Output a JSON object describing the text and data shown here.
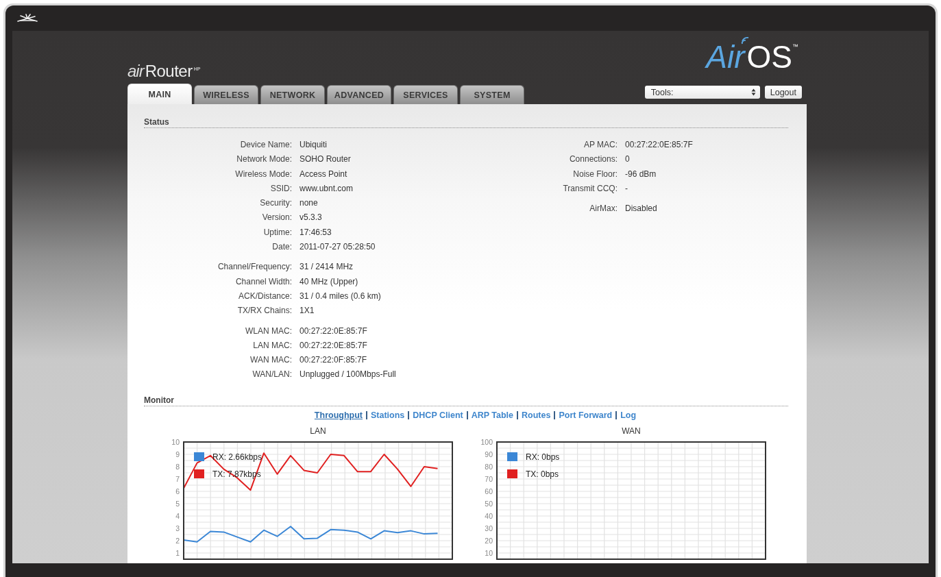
{
  "logo": {
    "prefix": "air",
    "name": "Router",
    "suffix": "HP"
  },
  "product_logo": {
    "air": "Air",
    "os": "OS",
    "tm": "™"
  },
  "tabs": [
    {
      "label": "MAIN",
      "selected": true
    },
    {
      "label": "WIRELESS",
      "selected": false
    },
    {
      "label": "NETWORK",
      "selected": false
    },
    {
      "label": "ADVANCED",
      "selected": false
    },
    {
      "label": "SERVICES",
      "selected": false
    },
    {
      "label": "SYSTEM",
      "selected": false
    }
  ],
  "tools": {
    "value": "Tools:"
  },
  "logout": "Logout",
  "status": {
    "title": "Status",
    "left": [
      [
        {
          "label": "Device Name:",
          "value": "Ubiquiti"
        },
        {
          "label": "Network Mode:",
          "value": "SOHO Router"
        },
        {
          "label": "Wireless Mode:",
          "value": "Access Point"
        },
        {
          "label": "SSID:",
          "value": "www.ubnt.com"
        },
        {
          "label": "Security:",
          "value": "none"
        },
        {
          "label": "Version:",
          "value": "v5.3.3"
        },
        {
          "label": "Uptime:",
          "value": "17:46:53"
        },
        {
          "label": "Date:",
          "value": "2011-07-27 05:28:50"
        }
      ],
      [
        {
          "label": "Channel/Frequency:",
          "value": "31 / 2414 MHz"
        },
        {
          "label": "Channel Width:",
          "value": "40 MHz (Upper)"
        },
        {
          "label": "ACK/Distance:",
          "value": "31 / 0.4 miles (0.6 km)"
        },
        {
          "label": "TX/RX Chains:",
          "value": "1X1"
        }
      ],
      [
        {
          "label": "WLAN MAC:",
          "value": "00:27:22:0E:85:7F"
        },
        {
          "label": "LAN MAC:",
          "value": "00:27:22:0E:85:7F"
        },
        {
          "label": "WAN MAC:",
          "value": "00:27:22:0F:85:7F"
        },
        {
          "label": "WAN/LAN:",
          "value": "Unplugged / 100Mbps-Full"
        }
      ]
    ],
    "right": [
      [
        {
          "label": "AP MAC:",
          "value": "00:27:22:0E:85:7F"
        },
        {
          "label": "Connections:",
          "value": "0"
        },
        {
          "label": "Noise Floor:",
          "value": "-96 dBm"
        },
        {
          "label": "Transmit CCQ:",
          "value": "-"
        }
      ],
      [
        {
          "label": "AirMax:",
          "value": "Disabled"
        }
      ]
    ]
  },
  "monitor": {
    "title": "Monitor",
    "links": [
      {
        "label": "Throughput",
        "selected": true
      },
      {
        "label": "Stations",
        "selected": false
      },
      {
        "label": "DHCP Client",
        "selected": false
      },
      {
        "label": "ARP Table",
        "selected": false
      },
      {
        "label": "Routes",
        "selected": false
      },
      {
        "label": "Port Forward",
        "selected": false
      },
      {
        "label": "Log",
        "selected": false
      }
    ],
    "charts": [
      {
        "title": "LAN",
        "chart_data": {
          "type": "line",
          "ylim": [
            0.5,
            10
          ],
          "yticks": [
            1,
            2,
            3,
            4,
            5,
            6,
            7,
            8,
            9,
            10
          ],
          "grid": true,
          "legend": true,
          "series": [
            {
              "name": "RX: 2.66kbps",
              "color": "#3b87d6",
              "values": [
                2.05,
                1.9,
                2.75,
                2.7,
                2.3,
                1.9,
                2.85,
                2.35,
                3.15,
                2.15,
                2.2,
                2.9,
                2.85,
                2.7,
                2.15,
                2.8,
                2.65,
                2.8,
                2.55,
                2.6
              ]
            },
            {
              "name": "TX: 7.87kbps",
              "color": "#e02020",
              "values": [
                6.25,
                8.3,
                8.9,
                7.8,
                7.1,
                6.1,
                9.1,
                7.4,
                8.9,
                7.7,
                7.5,
                9.0,
                8.9,
                7.6,
                7.6,
                9.0,
                7.8,
                6.4,
                8.0,
                7.85
              ]
            }
          ]
        }
      },
      {
        "title": "WAN",
        "chart_data": {
          "type": "line",
          "ylim": [
            5,
            100
          ],
          "yticks": [
            10,
            20,
            30,
            40,
            50,
            60,
            70,
            80,
            90,
            100
          ],
          "grid": true,
          "legend": true,
          "series": [
            {
              "name": "RX: 0bps",
              "color": "#3b87d6"
            },
            {
              "name": "TX: 0bps",
              "color": "#e02020"
            }
          ]
        }
      }
    ]
  }
}
